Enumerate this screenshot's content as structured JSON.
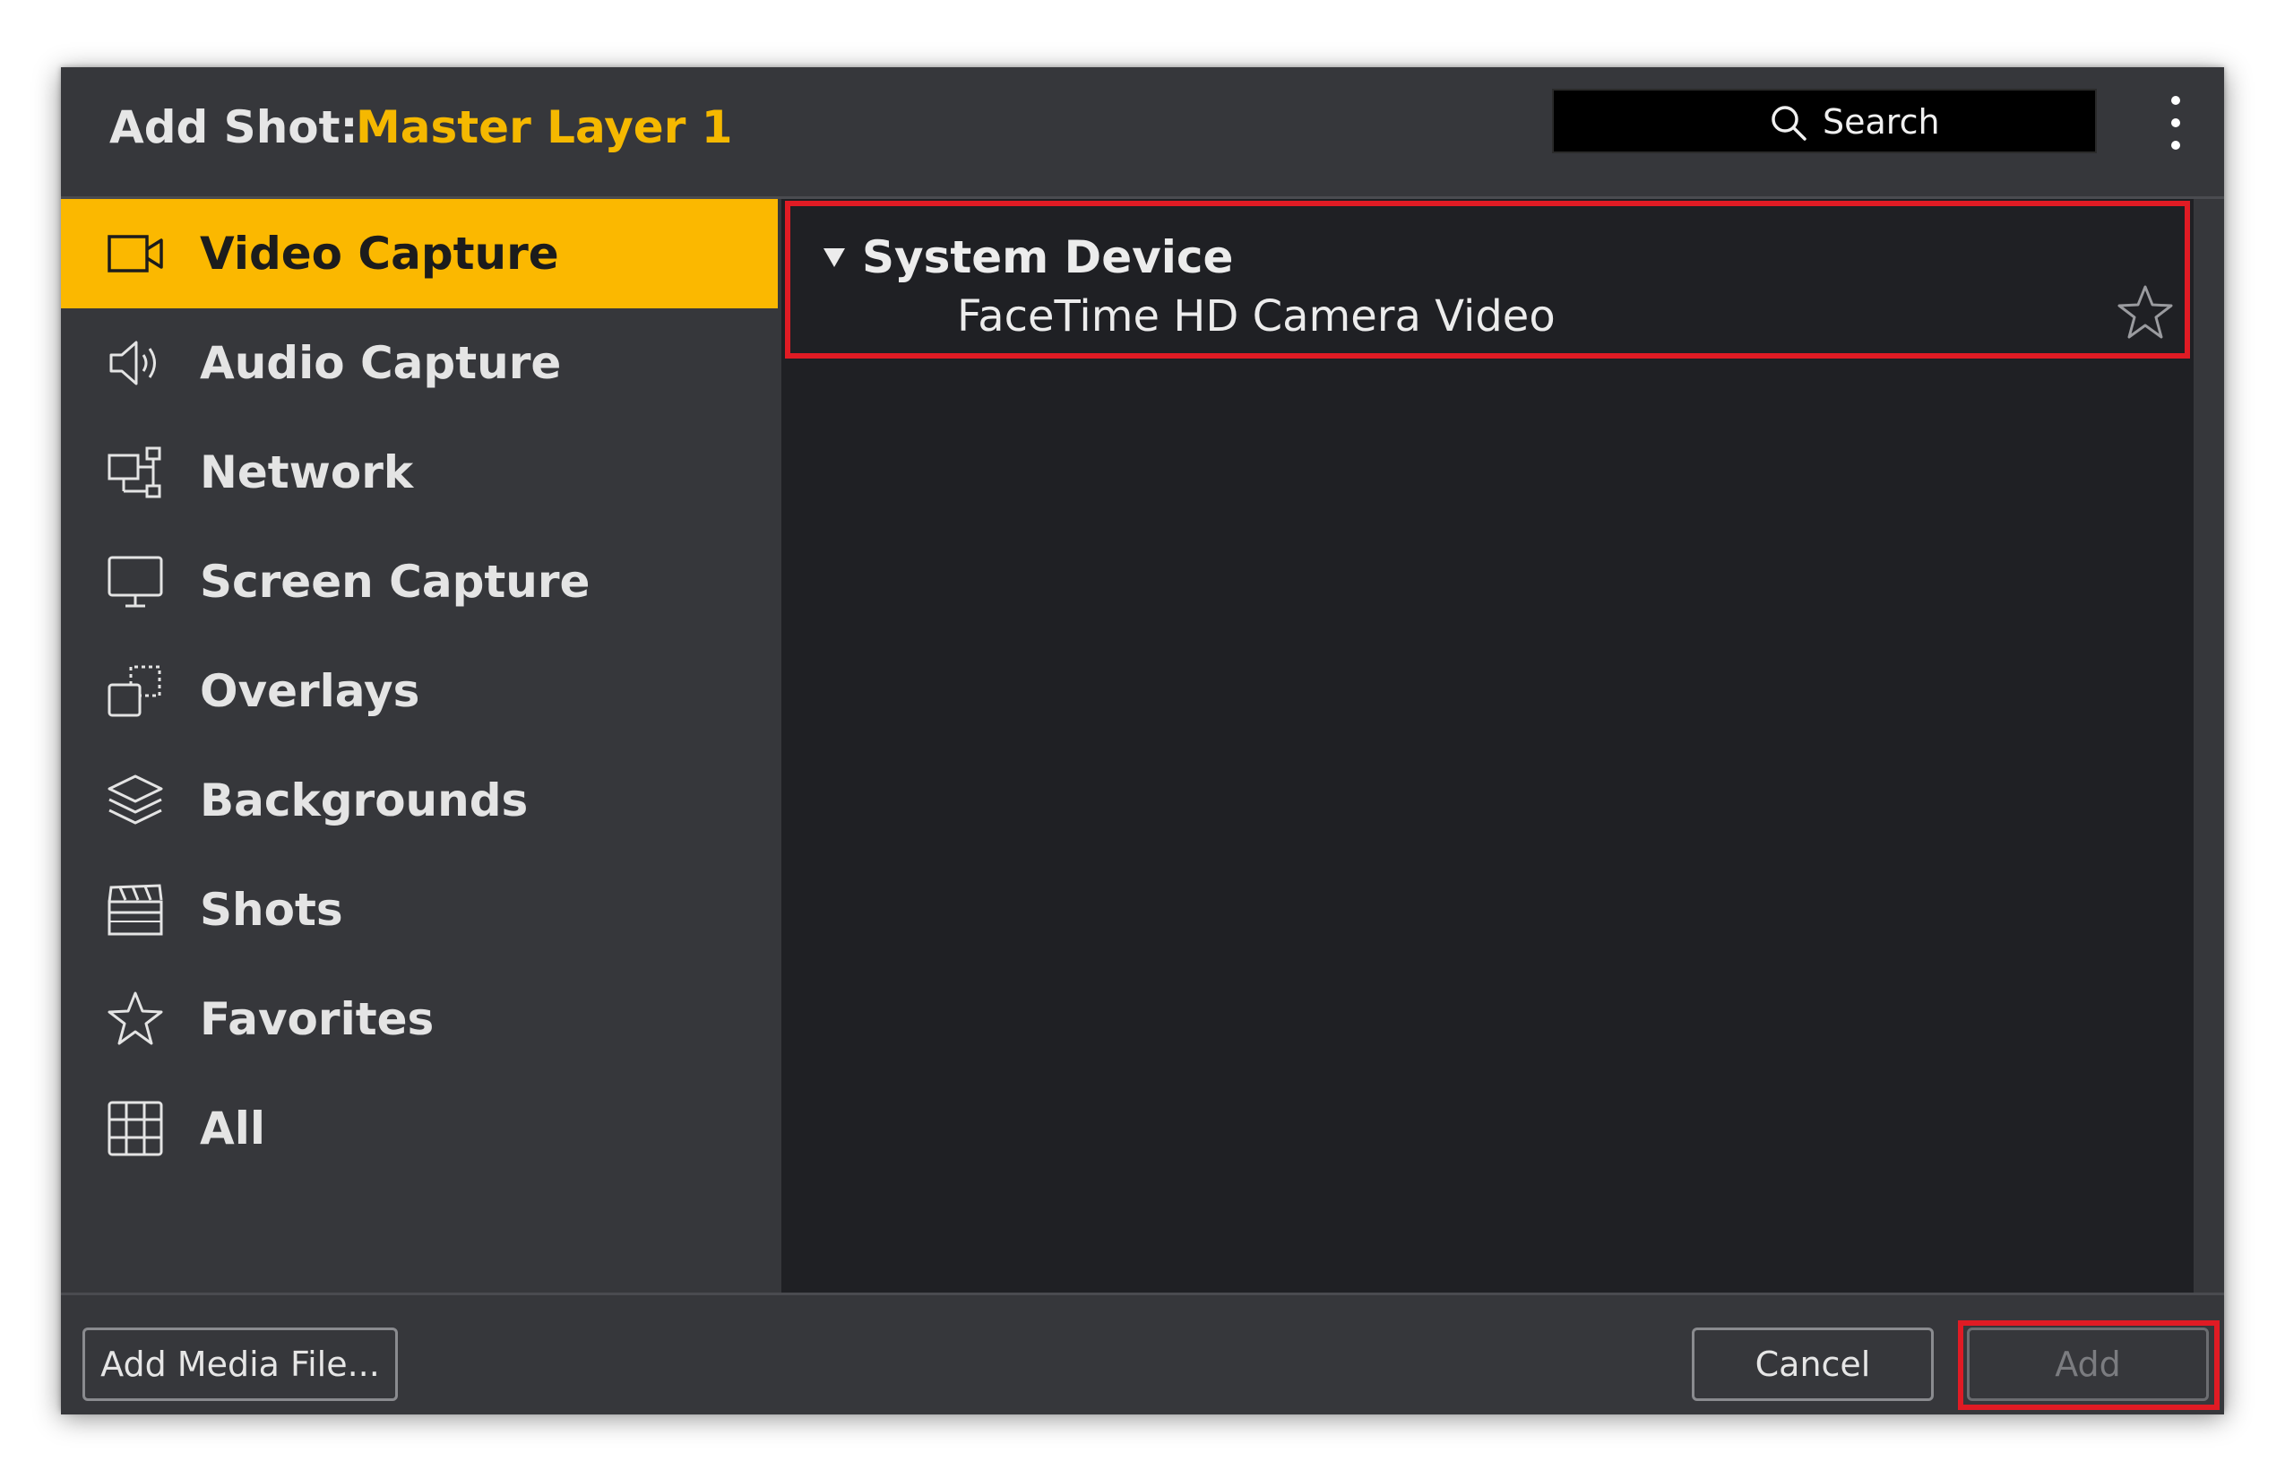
{
  "header": {
    "title_label": "Add Shot:",
    "title_value": "Master Layer 1",
    "search_placeholder": "Search",
    "menu_icon": "vertical-ellipsis-icon"
  },
  "sidebar": {
    "items": [
      {
        "label": "Video Capture",
        "icon": "video-camera-icon",
        "active": true
      },
      {
        "label": "Audio Capture",
        "icon": "speaker-icon",
        "active": false
      },
      {
        "label": "Network",
        "icon": "network-icon",
        "active": false
      },
      {
        "label": "Screen Capture",
        "icon": "monitor-icon",
        "active": false
      },
      {
        "label": "Overlays",
        "icon": "overlay-icon",
        "active": false
      },
      {
        "label": "Backgrounds",
        "icon": "layers-icon",
        "active": false
      },
      {
        "label": "Shots",
        "icon": "clapperboard-icon",
        "active": false
      },
      {
        "label": "Favorites",
        "icon": "star-icon",
        "active": false
      },
      {
        "label": "All",
        "icon": "grid-icon",
        "active": false
      }
    ]
  },
  "content": {
    "group_title": "System Device",
    "device_name": "FaceTime HD Camera Video",
    "favorite_icon": "star-outline-icon"
  },
  "footer": {
    "add_media_label": "Add Media File...",
    "cancel_label": "Cancel",
    "add_label": "Add"
  },
  "colors": {
    "accent": "#fbb800",
    "highlight": "#e01b24",
    "panel": "#36373b",
    "content_bg": "#1f2024"
  }
}
